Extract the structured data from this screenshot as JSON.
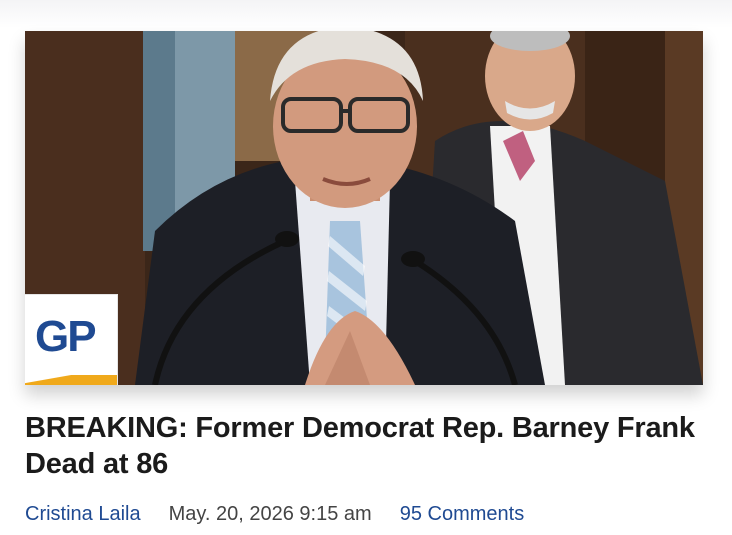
{
  "article": {
    "image_alt": "Barney Frank speaking at a microphone",
    "badge_text": "GP",
    "headline": "BREAKING: Former Democrat Rep. Barney Frank Dead at 86",
    "author": "Cristina Laila",
    "date": "May. 20, 2026 9:15 am",
    "comments": "95 Comments"
  },
  "colors": {
    "brand_blue": "#1f4a92",
    "brand_gold": "#f0a91b",
    "headline_text": "#1b1b1b",
    "meta_gray": "#444444"
  },
  "icons": [
    "gp-logo-icon"
  ]
}
